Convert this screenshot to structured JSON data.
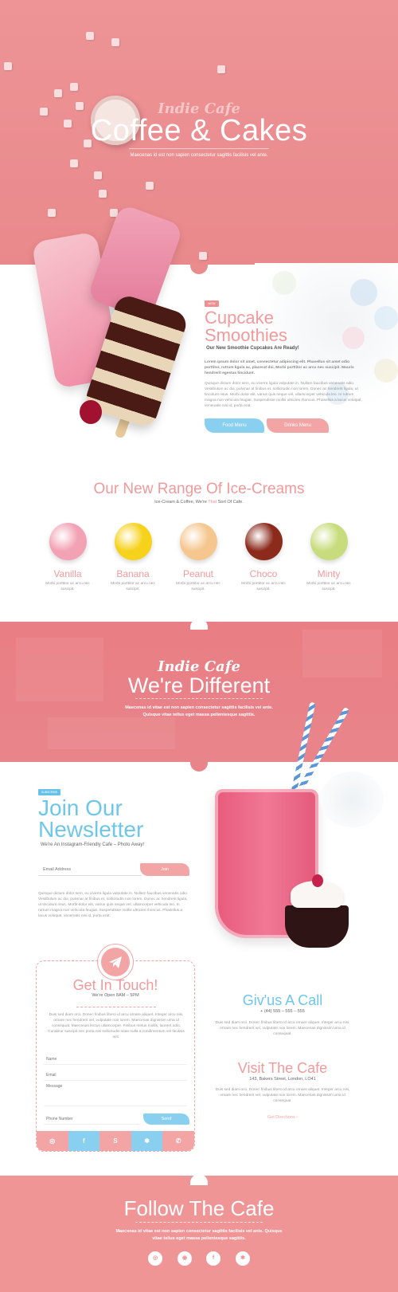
{
  "hero": {
    "script": "Indie Cafe",
    "title": "Coffee & Cakes",
    "subtitle": "Maecenas id est non sapien consectetur sagittis facilisis vel ante."
  },
  "smoothies": {
    "badge": "NEW",
    "title_line1": "Cupcake",
    "title_line2": "Smoothies",
    "subtitle": "Our New Smoothie Cupcakes Are Ready!",
    "paragraph1": "Lorem ipsum dolor sit amet, consectetur adipiscing elit. Phasellus sit amet odio porttitor, rutrum ligula ac, placerat dui. Morbi porttitor ac arcu nec suscipit. Mauris hendrerit egestas tincidunt.",
    "paragraph2": "Quisque dictum dolor sem, eu viverra ligula vulputate in. Nullam faucibus venenatis odio. Vestibulum ac dui, pulvinar at finibus et, sollicitudin non lorem. Donec ac hendrerit ligula, ut tincidunt risus. Morbi dolor elit, varius quis neque vel, ullamcorper vehicula leo. In rutrum magna non vehicula feugiat. Suspendisse mollis ultricies rhoncus. Phasellus a lacus volutpat, venenatis nisi id, porta erat.",
    "food_button": "Food Menu",
    "drinks_button": "Drinks Menu"
  },
  "icecreams": {
    "title": "Our New Range Of Ice-Creams",
    "subtitle_pre": "Ice-Cream & Coffee, We're ",
    "subtitle_highlight": "That",
    "subtitle_post": " Sort Of Cafe.",
    "items": [
      {
        "name": "Vanilla",
        "desc": "Morbi porttitor ac arcu nec suscipit.",
        "color": "#f2a2b4"
      },
      {
        "name": "Banana",
        "desc": "Morbi porttitor ac arcu nec suscipit.",
        "color": "#f6d21c"
      },
      {
        "name": "Peanut",
        "desc": "Morbi porttitor ac arcu nec suscipit.",
        "color": "#f5c78f"
      },
      {
        "name": "Choco",
        "desc": "Morbi porttitor ac arcu nec suscipit.",
        "color": "#8c2a1c"
      },
      {
        "name": "Minty",
        "desc": "Morbi porttitor ac arcu nec suscipit.",
        "color": "#c7dc7c"
      }
    ]
  },
  "different": {
    "script": "Indie Cafe",
    "title": "We're Different",
    "subtitle_line1": "Maecenas id vitae  est non sapien consectetur sagittis facilisis vel ante.",
    "subtitle_line2": "Quisque vitae tellus eget massa pellentesque sagittis."
  },
  "newsletter": {
    "badge": "SUBSCRIBE",
    "title_line1": "Join Our",
    "title_line2": "Newsletter",
    "subtitle": "We're An Instagram-Friendly Cafe – Photo Away!",
    "email_placeholder": "Email Address",
    "join_button": "Join",
    "paragraph": "Quisque dictum dolor sem, eu viverra ligula vulputate in. Nullam faucibus venenatis odio. Vestibulum ac dui, pulvinar at finibus et, sollicitudin non lorem. Donec ac hendrerit ligula, ut tincidunt risus. Morbi dolor elit, varius quis neque vel, ullamcorper vehicula leo. In rutrum magna non vehicula feugiat. Suspendisse mollis ultricies rhoncus. Phasellus a lacus volutpat, venenatis nisi id, porta erat."
  },
  "contact": {
    "title": "Get In Touch!",
    "hours": "We're Open 8AM – 5PM",
    "paragraph": "Duis sed diam orci. Donec finibus libero id arcu ornare aliquet. Integer arcu nisi, ornare nec hendrerit vel, vulputate non lorem. Maecenas  dignissim urna id consequat. Maecenas lectus ullamcorper. Finibus metus mollis, laoreet odio. Curabitur suscipit nec porta nisi sollicitudin vitae nulla a condimentum vel facilisis nec.",
    "name_placeholder": "Name",
    "email_placeholder": "Email",
    "message_placeholder": "Message",
    "phone_placeholder": "Phone Number",
    "send_button": "Send",
    "social_icons": [
      "instagram-icon",
      "facebook-icon",
      "skype-icon",
      "yelp-icon",
      "whatsapp-icon"
    ]
  },
  "call": {
    "title": "Giv'us A Call",
    "number": "+ (44) 555 – 555 – 555",
    "paragraph": "Duis sed diam orci. Donec finibus libero id arcu ornare aliquet. Integer arcu nisi, ornare nec hendrerit vel, vulputate non lorem. Maecenas dignissim urna id consequat."
  },
  "visit": {
    "title": "Visit The Cafe",
    "address": "143, Bakers Street, London, LO41",
    "paragraph": "Duis sed diam orci. Donec finibus libero id arcu ornare aliquet. Integer arcu nisi, ornare nec hendrerit vel, vulputate non lorem. Maecenas dignissim urna id consequat.",
    "directions": "Get Directions  ›"
  },
  "footer": {
    "title": "Follow The Cafe",
    "subtitle_line1": "Maecenas id vitae  est non sapien consectetur sagittis facilisis vel ante. Quisque",
    "subtitle_line2": "vitae tellus eget massa pellentesque sagittis.",
    "social_icons": [
      "instagram-icon",
      "dribbble-icon",
      "facebook-icon",
      "yelp-icon"
    ]
  },
  "colors": {
    "pink": "#ef9596",
    "pink_light": "#f3a5a6",
    "blue": "#89cff0"
  }
}
